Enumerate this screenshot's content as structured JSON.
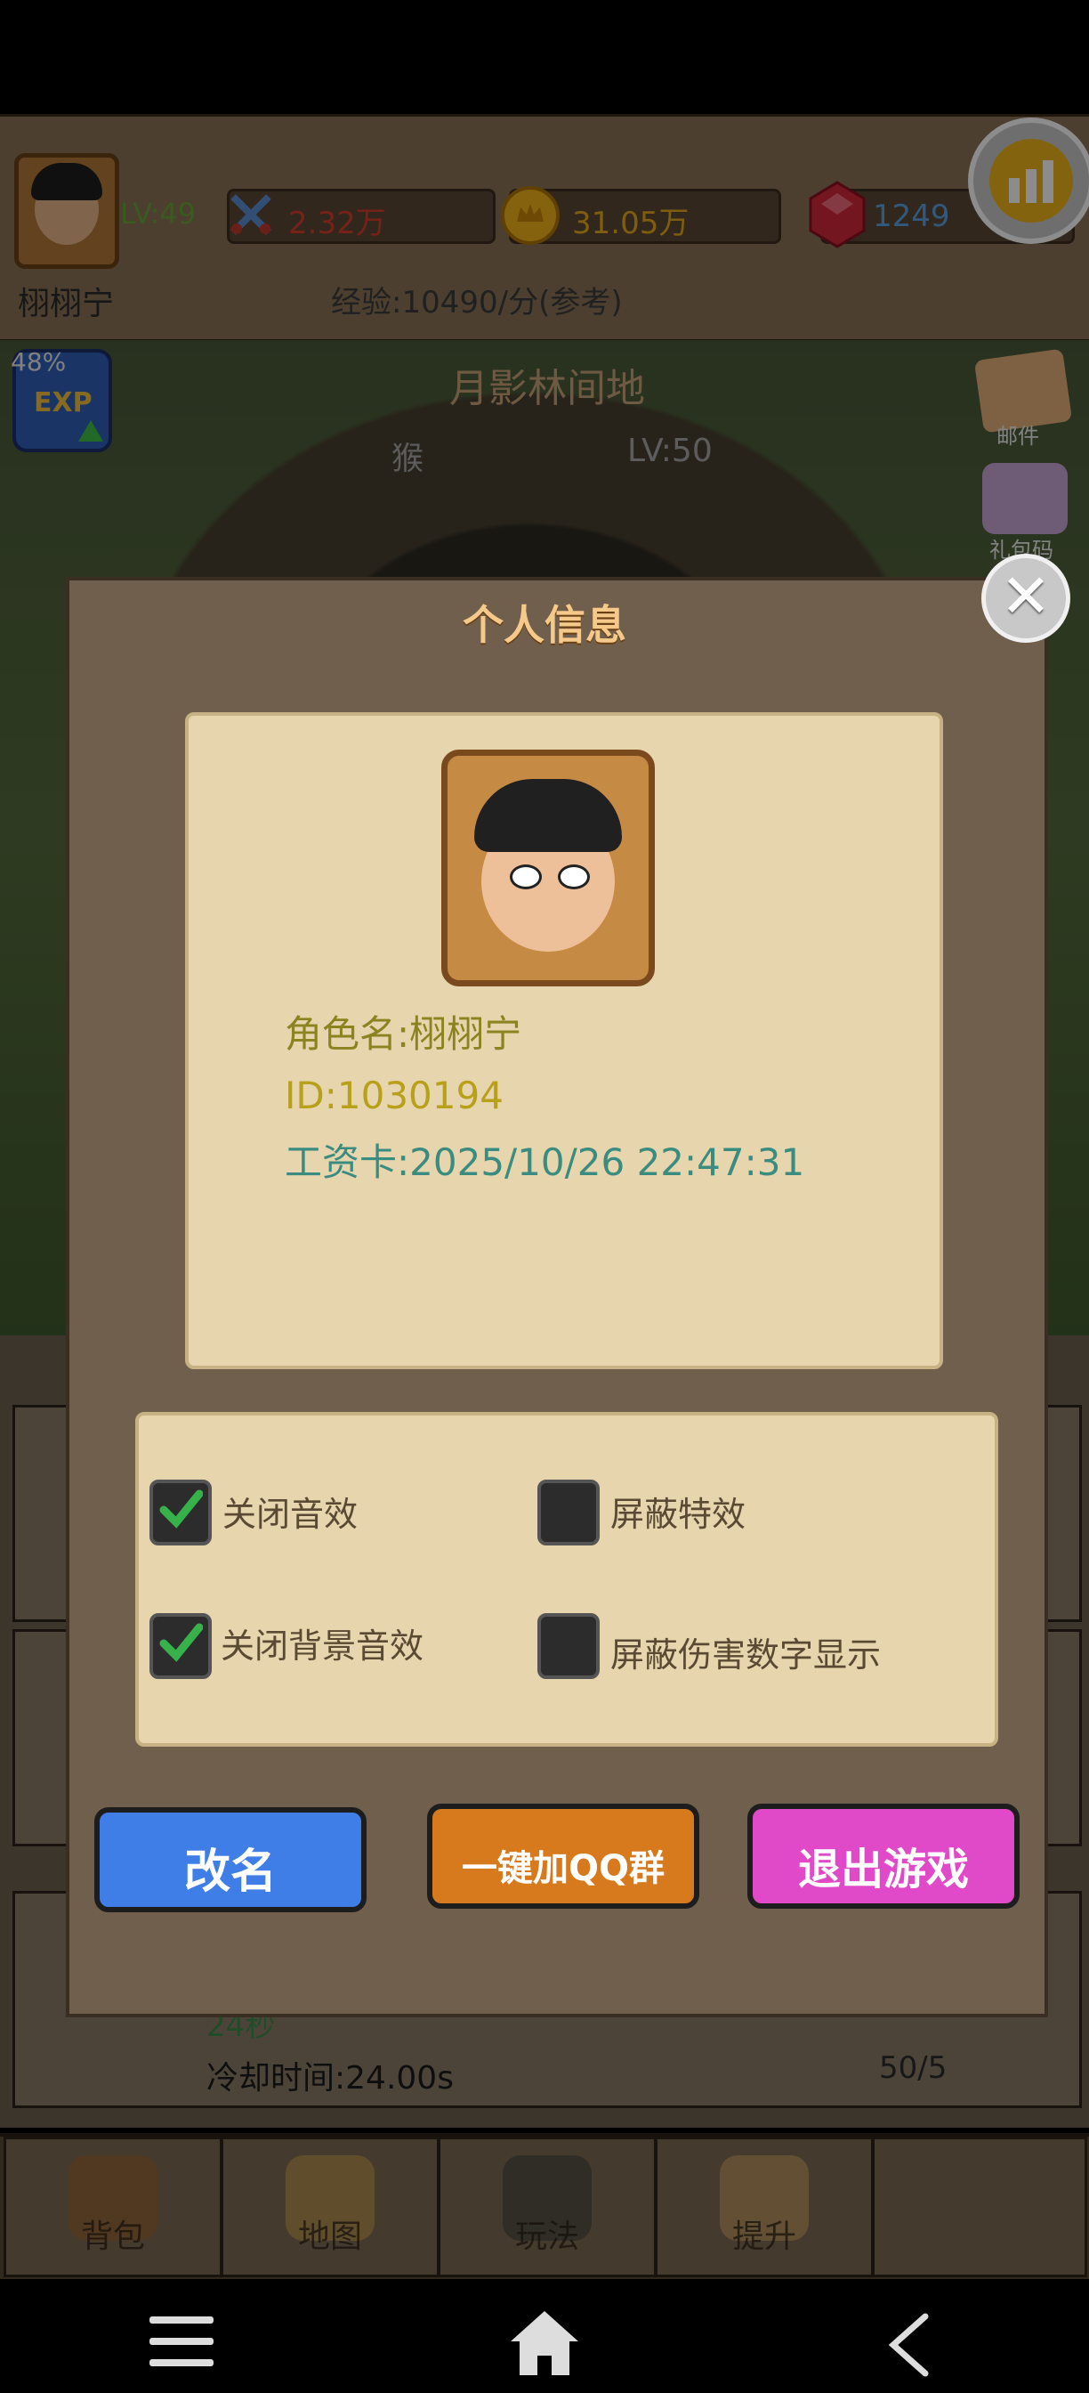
{
  "hud": {
    "level": "LV:49",
    "attack": "2.32万",
    "gold": "31.05万",
    "gems": "1249",
    "player_name": "栩栩宁",
    "exp_rate": "经验:10490/分(参考)",
    "stats_icon": "bar-chart-icon"
  },
  "scene": {
    "exp_percent": "48%",
    "map_title": "月影林间地",
    "monster": "猴",
    "monster_level": "LV:50",
    "mail_label": "邮件",
    "gift_label": "礼包码"
  },
  "background_list": {
    "seconds": "24秒",
    "cooldown": "冷却时间:24.00s",
    "count": "50/5"
  },
  "nav": {
    "items": [
      {
        "label": "背包",
        "icon": "backpack-icon"
      },
      {
        "label": "地图",
        "icon": "map-scroll-icon"
      },
      {
        "label": "玩法",
        "icon": "gamepad-icon"
      },
      {
        "label": "提升",
        "icon": "fist-icon"
      },
      {
        "label": "",
        "icon": ""
      }
    ]
  },
  "dialog": {
    "title": "个人信息",
    "close_icon": "close-icon",
    "character_name": "角色名:栩栩宁",
    "id": "ID:1030194",
    "salary_card": "工资卡:2025/10/26 22:47:31",
    "options": [
      {
        "label": "关闭音效",
        "checked": true
      },
      {
        "label": "屏蔽特效",
        "checked": false
      },
      {
        "label": "关闭背景音效",
        "checked": true
      },
      {
        "label": "屏蔽伤害数字显示",
        "checked": false
      }
    ],
    "buttons": {
      "rename": "改名",
      "join_qq": "一键加QQ群",
      "exit": "退出游戏"
    }
  },
  "colors": {
    "title": "#f5c98a",
    "rename_btn": "#3f7ee6",
    "qq_btn": "#d77a1d",
    "exit_btn": "#e049c8",
    "check_green": "#37b24a"
  }
}
